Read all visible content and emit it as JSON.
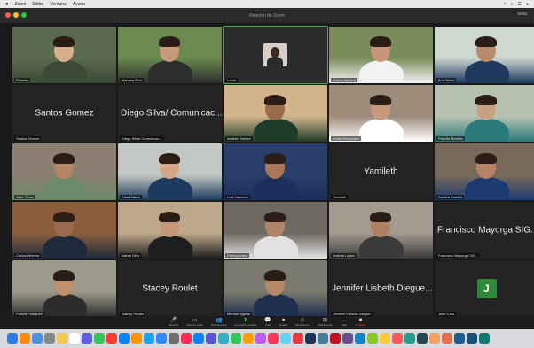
{
  "menubar": {
    "items": [
      "Zoom",
      "Editar",
      "Ventana",
      "Ayuda"
    ],
    "status": [
      "≈",
      "⌕",
      "☰",
      "●"
    ]
  },
  "window": {
    "title": "Reunión de Zoom",
    "right_label": "Vista"
  },
  "participants": [
    {
      "id": "p1",
      "label": "Roberto",
      "type": "video"
    },
    {
      "id": "p2",
      "label": "Marcela Ruiz",
      "type": "video"
    },
    {
      "id": "p3",
      "label": "Lucía",
      "type": "video-small",
      "active": true
    },
    {
      "id": "p4",
      "label": "Carlos Medina",
      "type": "video"
    },
    {
      "id": "p5",
      "label": "Ana María",
      "type": "video"
    },
    {
      "id": "p6",
      "display_name": "Santos Gomez",
      "label": "Santos Gomez",
      "type": "name"
    },
    {
      "id": "p7",
      "display_name": "Diego Silva/ Comunicac...",
      "label": "Diego Silva/ Comunicac...",
      "type": "name"
    },
    {
      "id": "p8",
      "label": "Andrés Gómez",
      "type": "video"
    },
    {
      "id": "p9",
      "label": "Karla Hernández",
      "type": "video"
    },
    {
      "id": "p10",
      "label": "Priscila Morales",
      "type": "video"
    },
    {
      "id": "p11",
      "label": "José Pérez",
      "type": "video"
    },
    {
      "id": "p12",
      "label": "Rosa María",
      "type": "video"
    },
    {
      "id": "p13",
      "label": "Luis Martínez",
      "type": "video"
    },
    {
      "id": "p14",
      "display_name": "Yamileth",
      "label": "Yamileth",
      "type": "name"
    },
    {
      "id": "p15",
      "label": "Sandra Castillo",
      "type": "video"
    },
    {
      "id": "p16",
      "label": "Carlos Herrera",
      "type": "video"
    },
    {
      "id": "p17",
      "label": "Isabel Ortiz",
      "type": "video"
    },
    {
      "id": "p18",
      "label": "Participantes",
      "type": "video"
    },
    {
      "id": "p19",
      "label": "Andrea López",
      "type": "video"
    },
    {
      "id": "p20",
      "display_name": "Francisco Mayorga SIG...",
      "label": "Francisco Mayorga SIG...",
      "type": "name"
    },
    {
      "id": "p21",
      "label": "Fabiola Vásquez",
      "type": "video"
    },
    {
      "id": "p22",
      "display_name": "Stacey Roulet",
      "label": "Stacey Roulet",
      "type": "name"
    },
    {
      "id": "p23",
      "label": "Manuel Aguilar",
      "type": "video"
    },
    {
      "id": "p24",
      "display_name": "Jennifer Lisbeth Diegue...",
      "label": "Jennifer Lisbeth Diegue...",
      "type": "name"
    },
    {
      "id": "p25",
      "display_name": "J",
      "label": "Juan Cruz",
      "type": "avatar"
    }
  ],
  "controls": [
    {
      "icon": "mic-icon",
      "glyph": "🎤",
      "label": "Silenciar"
    },
    {
      "icon": "video-icon",
      "glyph": "▭",
      "label": "Detener video"
    },
    {
      "icon": "participants-icon",
      "glyph": "👥",
      "label": "Participantes"
    },
    {
      "icon": "share-icon",
      "glyph": "⬆",
      "label": "Compartir pantalla"
    },
    {
      "icon": "chat-icon",
      "glyph": "💬",
      "label": "Chat"
    },
    {
      "icon": "record-icon",
      "glyph": "⏺",
      "label": "Grabar"
    },
    {
      "icon": "reactions-icon",
      "glyph": "☺",
      "label": "Reacciones"
    },
    {
      "icon": "apps-icon",
      "glyph": "⊞",
      "label": "Aplicaciones"
    },
    {
      "icon": "more-icon",
      "glyph": "…",
      "label": "Más"
    },
    {
      "icon": "end-icon",
      "glyph": "■",
      "label": "Finalizar"
    }
  ],
  "dock_colors": [
    "#2f7de1",
    "#ff8c00",
    "#4a90e2",
    "#888888",
    "#f2c94c",
    "#ffffff",
    "#5e5ce6",
    "#34c759",
    "#ff3b30",
    "#0a84ff",
    "#ff9500",
    "#1ea1f2",
    "#2d8cff",
    "#6e6e6e",
    "#ff2d55",
    "#0a84ff",
    "#5856d6",
    "#30b0c7",
    "#34c759",
    "#ff9f0a",
    "#bf5af2",
    "#ff375f",
    "#64d2ff",
    "#e63946",
    "#1d3557",
    "#457b9d",
    "#c1121f",
    "#6a4c93",
    "#1982c4",
    "#8ac926",
    "#ffca3a",
    "#ff595e",
    "#2a9d8f",
    "#264653",
    "#f4a261",
    "#e76f51",
    "#1e6091",
    "#184e77",
    "#0b7a75"
  ]
}
